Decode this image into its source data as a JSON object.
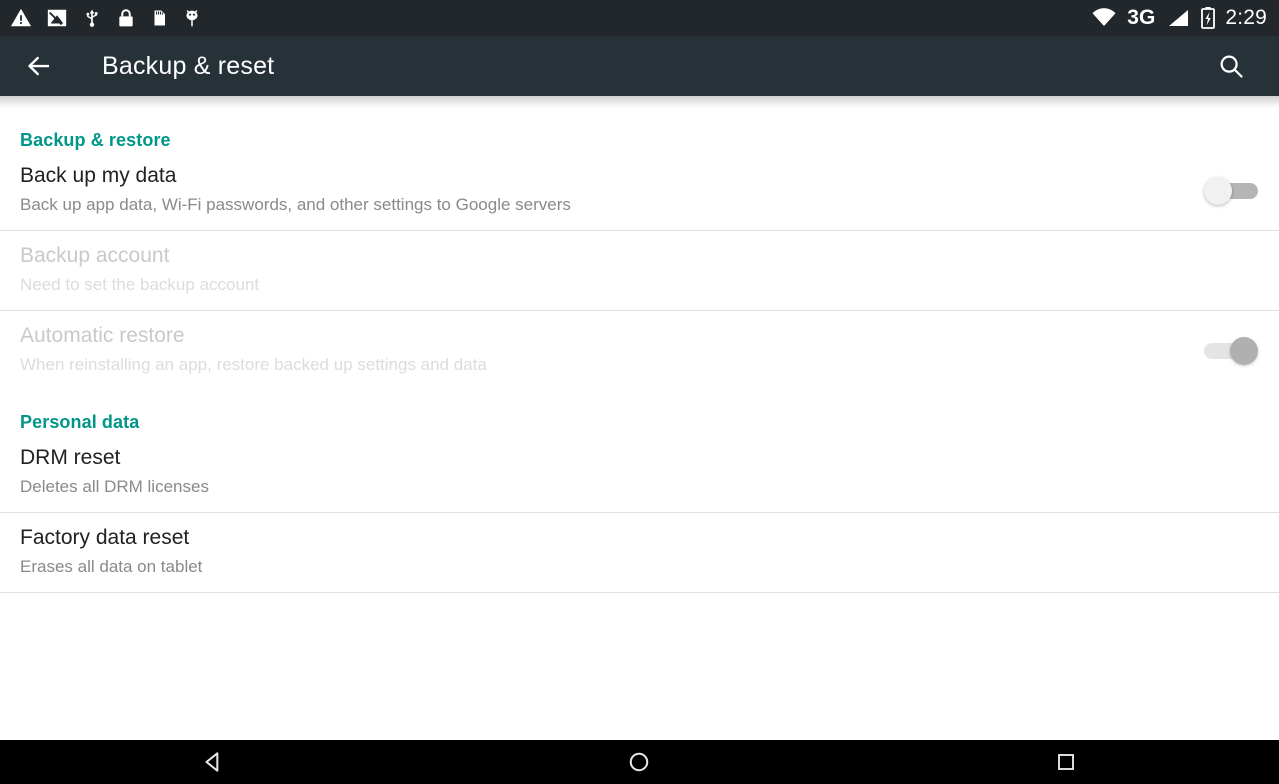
{
  "status_bar": {
    "left_icons": [
      {
        "name": "warning-icon"
      },
      {
        "name": "screenshot-icon"
      },
      {
        "name": "usb-icon"
      },
      {
        "name": "lock-icon"
      },
      {
        "name": "sd-card-icon"
      },
      {
        "name": "android-debug-icon"
      }
    ],
    "wifi_icon": "wifi-icon",
    "network_label": "3G",
    "signal_icon": "signal-bars-icon",
    "battery_icon": "battery-charging-icon",
    "time": "2:29",
    "background_color": "#21272b"
  },
  "action_bar": {
    "back_icon": "back-arrow-icon",
    "title": "Backup & reset",
    "search_icon": "search-icon",
    "background_color": "#263238"
  },
  "colors": {
    "accent_teal": "#009688",
    "title_text": "#212121",
    "summary_text": "#8a8a8a",
    "disabled_title": "#c9c9c9",
    "disabled_summary": "#dcdcdc",
    "divider": "#e0e0e0"
  },
  "sections": [
    {
      "header": "Backup & restore",
      "items": [
        {
          "title": "Back up my data",
          "summary": "Back up app data, Wi-Fi passwords, and other settings to Google servers",
          "has_switch": true,
          "switch_on": false,
          "disabled": false
        },
        {
          "title": "Backup account",
          "summary": "Need to set the backup account",
          "has_switch": false,
          "switch_on": false,
          "disabled": true
        },
        {
          "title": "Automatic restore",
          "summary": "When reinstalling an app, restore backed up settings and data",
          "has_switch": true,
          "switch_on": true,
          "disabled": true
        }
      ]
    },
    {
      "header": "Personal data",
      "items": [
        {
          "title": "DRM reset",
          "summary": "Deletes all DRM licenses",
          "has_switch": false,
          "switch_on": false,
          "disabled": false
        },
        {
          "title": "Factory data reset",
          "summary": "Erases all data on tablet",
          "has_switch": false,
          "switch_on": false,
          "disabled": false
        }
      ]
    }
  ],
  "nav_bar": {
    "back_icon": "nav-back-triangle-icon",
    "home_icon": "nav-home-circle-icon",
    "recents_icon": "nav-recents-square-icon",
    "background_color": "#000000"
  }
}
